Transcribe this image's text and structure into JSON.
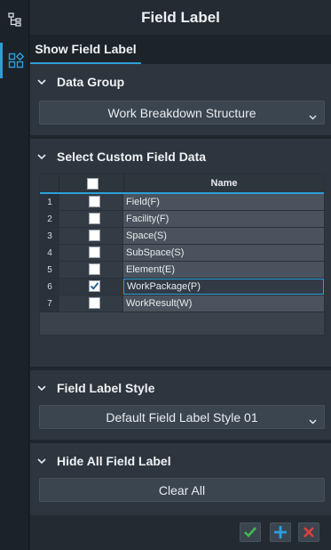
{
  "panel": {
    "title": "Field Label"
  },
  "tabs": [
    {
      "label": "Show Field Label",
      "active": true
    }
  ],
  "data_group": {
    "header": "Data Group",
    "selected": "Work Breakdown Structure"
  },
  "custom_field": {
    "header": "Select Custom Field Data",
    "column_name": "Name",
    "rows": [
      {
        "num": "1",
        "name": "Field(F)",
        "checked": false
      },
      {
        "num": "2",
        "name": "Facility(F)",
        "checked": false
      },
      {
        "num": "3",
        "name": "Space(S)",
        "checked": false
      },
      {
        "num": "4",
        "name": "SubSpace(S)",
        "checked": false
      },
      {
        "num": "5",
        "name": "Element(E)",
        "checked": false
      },
      {
        "num": "6",
        "name": "WorkPackage(P)",
        "checked": true
      },
      {
        "num": "7",
        "name": "WorkResult(W)",
        "checked": false
      }
    ]
  },
  "label_style": {
    "header": "Field Label Style",
    "selected": "Default Field Label Style 01"
  },
  "hide_all": {
    "header": "Hide All Field Label",
    "button": "Clear All"
  },
  "footer": {
    "confirm_icon": "check-icon",
    "add_icon": "plus-icon",
    "close_icon": "x-icon"
  },
  "colors": {
    "accent": "#2c9fd8",
    "confirm": "#3dbb4f",
    "add": "#2c9fd8",
    "close": "#e0403a"
  }
}
